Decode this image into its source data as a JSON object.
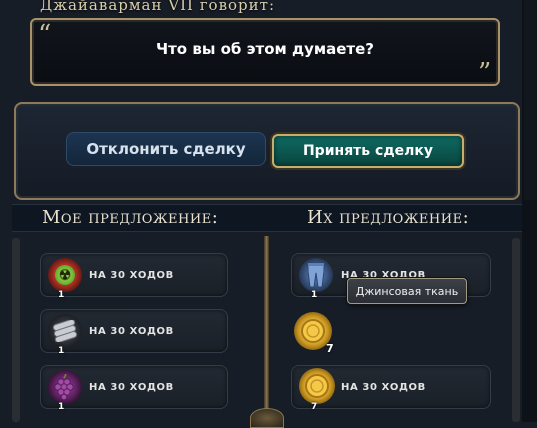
{
  "header": {
    "speaker": "Джайаварман VII говорит:",
    "quote_open": "“",
    "quote_close": "”",
    "message": "Что вы об этом думаете?"
  },
  "actions": {
    "reject_label": "Отклонить сделку",
    "accept_label": "Принять сделку"
  },
  "columns": {
    "my_title": "Мое предложение:",
    "their_title": "Их предложение:"
  },
  "my_offer": [
    {
      "icon": "uranium-icon",
      "glyph": "☢",
      "label": "НА 30 ХОДОВ",
      "count": "1"
    },
    {
      "icon": "steel-icon",
      "glyph": "▰",
      "label": "НА 30 ХОДОВ",
      "count": "1"
    },
    {
      "icon": "wine-icon",
      "glyph": "🍇",
      "label": "НА 30 ХОДОВ",
      "count": "1"
    }
  ],
  "their_offer": [
    {
      "icon": "jeans-icon",
      "glyph": "👖",
      "label": "НА 30 ХОДОВ",
      "count": "1"
    },
    {
      "icon": "gold-icon",
      "glyph": "●",
      "label": "",
      "count": "7"
    },
    {
      "icon": "gold-icon",
      "glyph": "●",
      "label": "НА 30 ХОДОВ",
      "count": "7"
    }
  ],
  "tooltip": "Джинсовая ткань",
  "colors": {
    "background": "#171d26",
    "accent_gold": "#c9ad6c",
    "accept_teal": "#0f6b62",
    "reject_blue": "#1c3550"
  }
}
